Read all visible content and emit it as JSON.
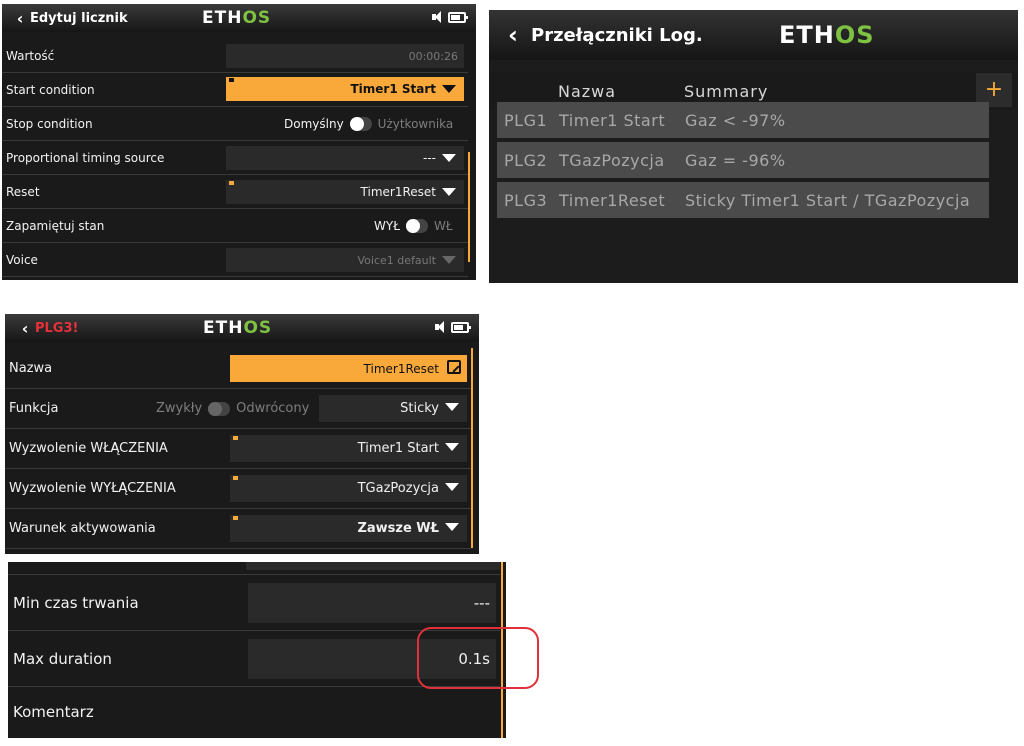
{
  "p1": {
    "title": "Edytuj licznik",
    "logo_a": "ETH",
    "logo_b": "OS",
    "rows": {
      "value_label": "Wartość",
      "value": "00:00:26",
      "start_label": "Start condition",
      "start_value": "Timer1 Start",
      "stop_label": "Stop condition",
      "stop_left": "Domyślny",
      "stop_right": "Użytkownika",
      "prop_label": "Proportional timing source",
      "prop_value": "---",
      "reset_label": "Reset",
      "reset_value": "Timer1Reset",
      "persist_label": "Zapamiętuj stan",
      "persist_left": "WYŁ",
      "persist_right": "WŁ",
      "voice_label": "Voice",
      "voice_value": "Voice1  default"
    }
  },
  "p2": {
    "title": "Przełączniki Log.",
    "logo_a": "ETH",
    "logo_b": "OS",
    "col_name": "Nazwa",
    "col_summary": "Summary",
    "plus": "+",
    "rows": [
      {
        "id": "PLG1",
        "name": "Timer1 Start",
        "summary": "Gaz < -97%"
      },
      {
        "id": "PLG2",
        "name": "TGazPozycja",
        "summary": "Gaz = -96%"
      },
      {
        "id": "PLG3",
        "name": "Timer1Reset",
        "summary": "Sticky Timer1 Start / TGazPozycja"
      }
    ]
  },
  "p3": {
    "title": "PLG3!",
    "title_color": "#e8303a",
    "logo_a": "ETH",
    "logo_b": "OS",
    "name_label": "Nazwa",
    "name_value": "Timer1Reset",
    "func_label": "Funkcja",
    "func_left": "Zwykły",
    "func_right": "Odwrócony",
    "func_value": "Sticky",
    "on_label": "Wyzwolenie WŁĄCZENIA",
    "on_value": "Timer1 Start",
    "off_label": "Wyzwolenie WYŁĄCZENIA",
    "off_value": "TGazPozycja",
    "act_label": "Warunek aktywowania",
    "act_value": "Zawsze WŁ"
  },
  "p4": {
    "min_label": "Min czas trwania",
    "min_value": "---",
    "max_label": "Max duration",
    "max_value": "0.1s",
    "comment_label": "Komentarz"
  },
  "colors": {
    "accent": "#f9a93a",
    "logo_os": "#7ec242",
    "highlight": "#e0303a"
  }
}
